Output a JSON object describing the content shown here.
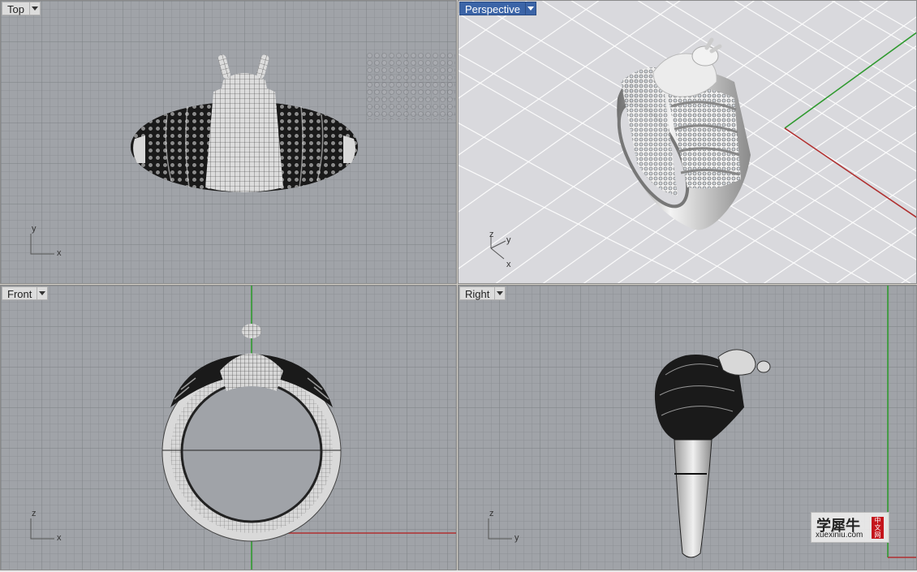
{
  "viewports": {
    "top": {
      "label": "Top",
      "axis_a": "y",
      "axis_b": "x"
    },
    "perspective": {
      "label": "Perspective",
      "axis_z": "z",
      "axis_y": "y",
      "axis_x": "x"
    },
    "front": {
      "label": "Front",
      "axis_a": "z",
      "axis_b": "x"
    },
    "right": {
      "label": "Right",
      "axis_a": "z",
      "axis_b": "y"
    }
  },
  "watermark": {
    "brand_cn": "学犀牛",
    "url": "xuexiniu.com",
    "seal": "中文网"
  },
  "colors": {
    "ortho_bg": "#a0a3a8",
    "persp_bg": "#d9d9dd",
    "grid": "#8e9196",
    "grid_major": "#7d8085",
    "active_label": "#3b64a7",
    "x_axis": "#b03030",
    "y_axis": "#2f9a2f"
  }
}
